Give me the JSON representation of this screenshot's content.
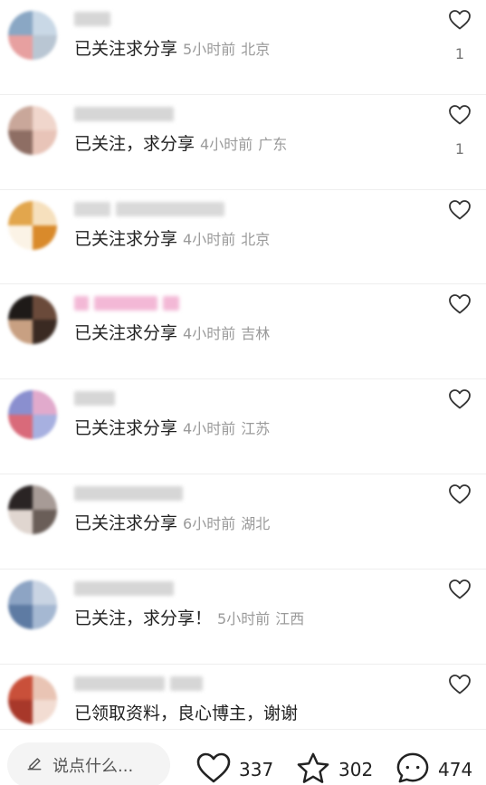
{
  "comments": [
    {
      "text": "已关注求分享",
      "time": "5小时前",
      "location": "北京",
      "likes": "1",
      "avatar": [
        "#8aa7c4",
        "#c9d8e6",
        "#e7a0a0",
        "#b9c6d3"
      ],
      "name_widths": [
        40
      ],
      "name_color": "#d6d6d6"
    },
    {
      "text": "已关注，求分享",
      "time": "4小时前",
      "location": "广东",
      "likes": "1",
      "avatar": [
        "#c9a79a",
        "#f0d6cc",
        "#8e6e64",
        "#e8c4b8"
      ],
      "name_widths": [
        110
      ],
      "name_color": "#d6d6d6"
    },
    {
      "text": "已关注求分享",
      "time": "4小时前",
      "location": "北京",
      "likes": "",
      "avatar": [
        "#e2a64d",
        "#f6e0bd",
        "#fbf3e6",
        "#d98a2b"
      ],
      "name_widths": [
        40,
        120
      ],
      "name_color": "#d9d9d9"
    },
    {
      "text": "已关注求分享",
      "time": "4小时前",
      "location": "吉林",
      "likes": "",
      "avatar": [
        "#1e1a18",
        "#6a4a3a",
        "#c8a082",
        "#3a2a22"
      ],
      "name_widths": [
        16,
        70,
        18
      ],
      "name_color": "#f3b8d6"
    },
    {
      "text": "已关注求分享",
      "time": "4小时前",
      "location": "江苏",
      "likes": "",
      "avatar": [
        "#8a8fcf",
        "#e1aacc",
        "#d96a7a",
        "#a7b0e0"
      ],
      "name_widths": [
        45
      ],
      "name_color": "#d6d6d6"
    },
    {
      "text": "已关注求分享",
      "time": "6小时前",
      "location": "湖北",
      "likes": "",
      "avatar": [
        "#2a2424",
        "#a79b96",
        "#e0d6d0",
        "#6a5e58"
      ],
      "name_widths": [
        120
      ],
      "name_color": "#d6d6d6"
    },
    {
      "text": "已关注，求分享！",
      "time": "5小时前",
      "location": "江西",
      "likes": "",
      "avatar": [
        "#8da4c4",
        "#c9d4e3",
        "#5e7ba3",
        "#a5b8d2"
      ],
      "name_widths": [
        110
      ],
      "name_color": "#d6d6d6"
    },
    {
      "text": "已领取资料，良心博主，谢谢",
      "time": "",
      "location": "",
      "likes": "",
      "avatar": [
        "#c9503a",
        "#e9c4b4",
        "#a8382a",
        "#f2dcd2"
      ],
      "name_widths": [
        100,
        36
      ],
      "name_color": "#d6d6d6"
    }
  ],
  "bottom": {
    "input_placeholder": "说点什么...",
    "like_count": "337",
    "favorite_count": "302",
    "comment_count": "474"
  },
  "icons": {
    "edit": "pencil-icon",
    "like": "heart-icon",
    "favorite": "star-icon",
    "comment": "comment-bubble-icon"
  }
}
